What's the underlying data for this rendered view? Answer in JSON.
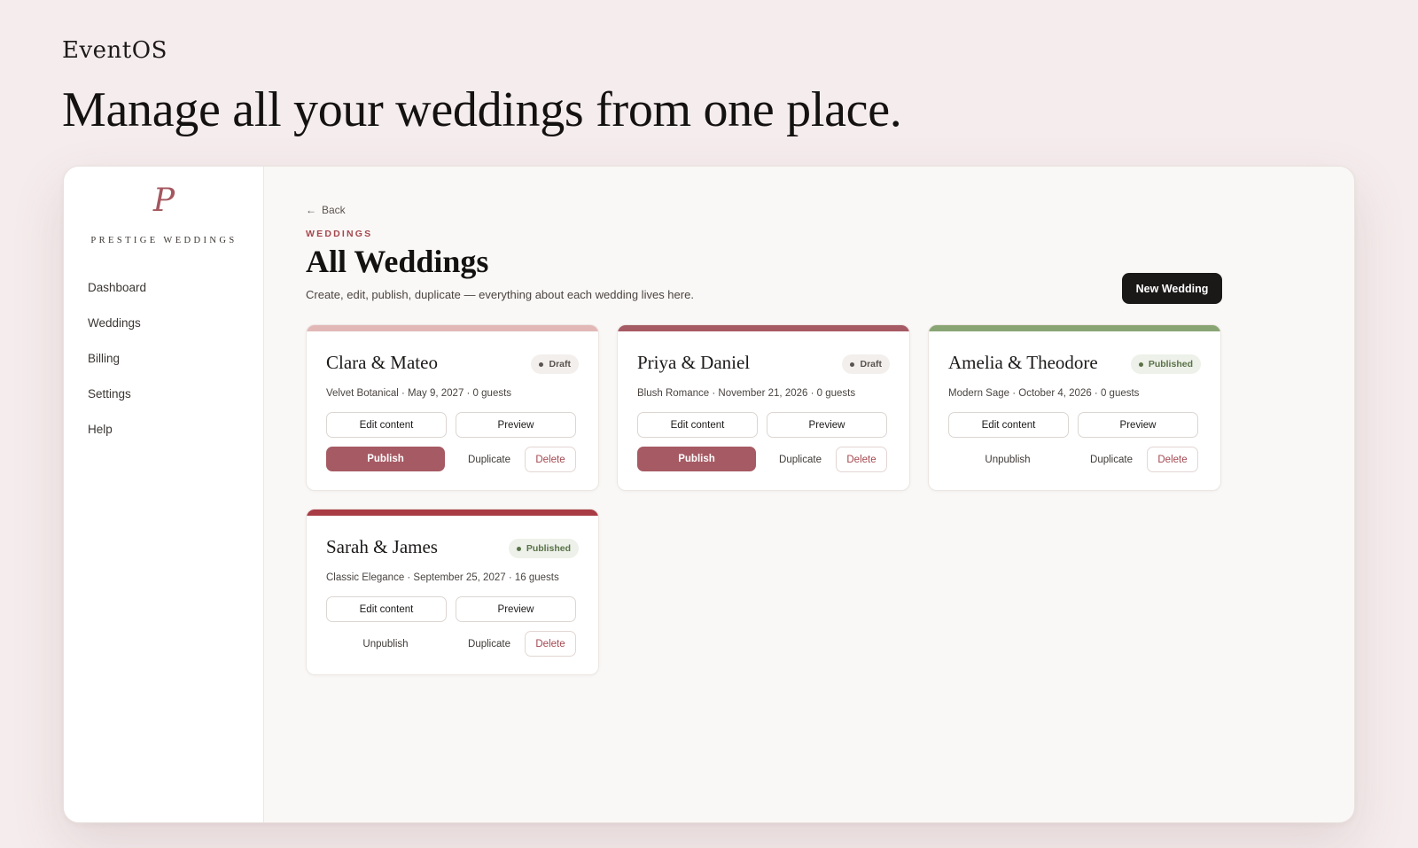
{
  "page": {
    "brand": "EventOS",
    "headline": "Manage all your weddings from one place."
  },
  "sidebar": {
    "logo_mark": "P",
    "logo_text": "PRESTIGE WEDDINGS",
    "items": [
      {
        "label": "Dashboard"
      },
      {
        "label": "Weddings"
      },
      {
        "label": "Billing"
      },
      {
        "label": "Settings"
      },
      {
        "label": "Help"
      }
    ]
  },
  "main": {
    "back_arrow": "←",
    "back_label": "Back",
    "eyebrow": "WEDDINGS",
    "title": "All Weddings",
    "subtitle": "Create, edit, publish, duplicate — everything about each wedding lives here.",
    "new_button": "New Wedding"
  },
  "colors": {
    "accent_rose": "#a65a63",
    "bar_blush": "#e2b8b7",
    "bar_rose": "#a65a63",
    "bar_sage": "#8aa574",
    "bar_burgundy": "#a93b45",
    "published_green": "#5a7248"
  },
  "cards": [
    {
      "name": "Clara & Mateo",
      "status": "Draft",
      "meta": "Velvet Botanical · May 9, 2027 · 0 guests",
      "edit": "Edit content",
      "preview": "Preview",
      "primary": "Publish",
      "duplicate": "Duplicate",
      "delete": "Delete"
    },
    {
      "name": "Priya & Daniel",
      "status": "Draft",
      "meta": "Blush Romance · November 21, 2026 · 0 guests",
      "edit": "Edit content",
      "preview": "Preview",
      "primary": "Publish",
      "duplicate": "Duplicate",
      "delete": "Delete"
    },
    {
      "name": "Amelia & Theodore",
      "status": "Published",
      "meta": "Modern Sage · October 4, 2026 · 0 guests",
      "edit": "Edit content",
      "preview": "Preview",
      "primary": "Unpublish",
      "duplicate": "Duplicate",
      "delete": "Delete"
    },
    {
      "name": "Sarah & James",
      "status": "Published",
      "meta": "Classic Elegance · September 25, 2027 · 16 guests",
      "edit": "Edit content",
      "preview": "Preview",
      "primary": "Unpublish",
      "duplicate": "Duplicate",
      "delete": "Delete"
    }
  ]
}
